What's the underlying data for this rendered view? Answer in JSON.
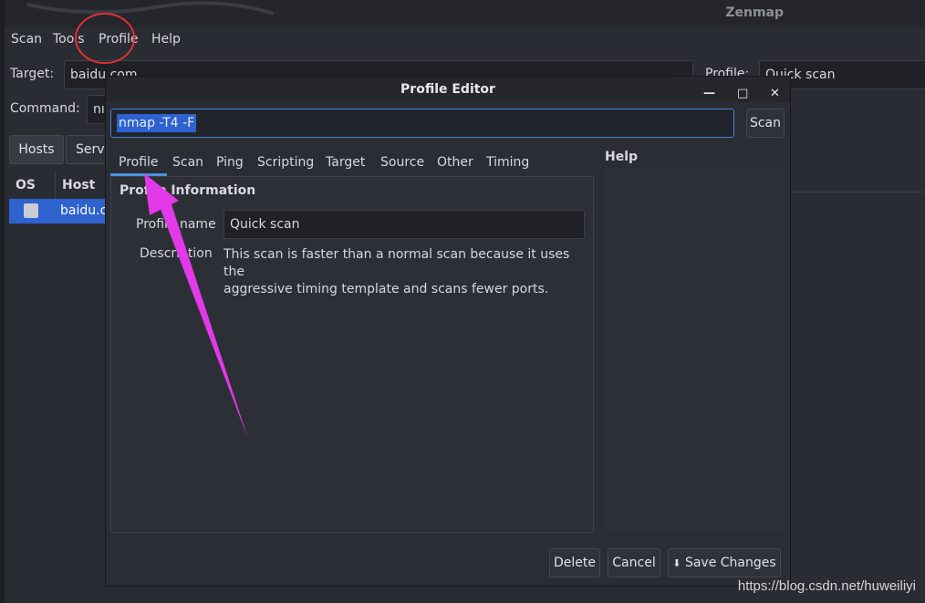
{
  "window": {
    "title": "Zenmap"
  },
  "menu": [
    "Scan",
    "Tools",
    "Profile",
    "Help"
  ],
  "target": {
    "label": "Target:",
    "value": "baidu.com"
  },
  "profile": {
    "label": "Profile:",
    "value": "Quick scan"
  },
  "command": {
    "label": "Command:",
    "value_partial": "nı"
  },
  "main_tabs": [
    "Hosts",
    "Servi"
  ],
  "host_table": {
    "headers": [
      "OS",
      "Host"
    ],
    "rows": [
      {
        "host": "baidu.cc"
      }
    ]
  },
  "dialog": {
    "title": "Profile Editor",
    "command": "nmap -T4 -F",
    "scan_button": "Scan",
    "tabs": [
      "Profile",
      "Scan",
      "Ping",
      "Scripting",
      "Target",
      "Source",
      "Other",
      "Timing"
    ],
    "active_tab": "Profile",
    "help_label": "Help",
    "section_title": "Profile Information",
    "profile_name_label": "Profile name",
    "profile_name_value": "Quick scan",
    "description_label": "Description",
    "description_line1": "This scan is faster than a normal scan because it uses the",
    "description_line2": "aggressive timing template and scans fewer ports.",
    "buttons": {
      "delete": "Delete",
      "cancel": "Cancel",
      "save": "Save Changes"
    }
  },
  "watermark": "https://blog.csdn.net/huweiliyi",
  "annotation_colors": {
    "circle": "#e03030",
    "arrow": "#e23ae8",
    "selection": "#2d62cf"
  }
}
